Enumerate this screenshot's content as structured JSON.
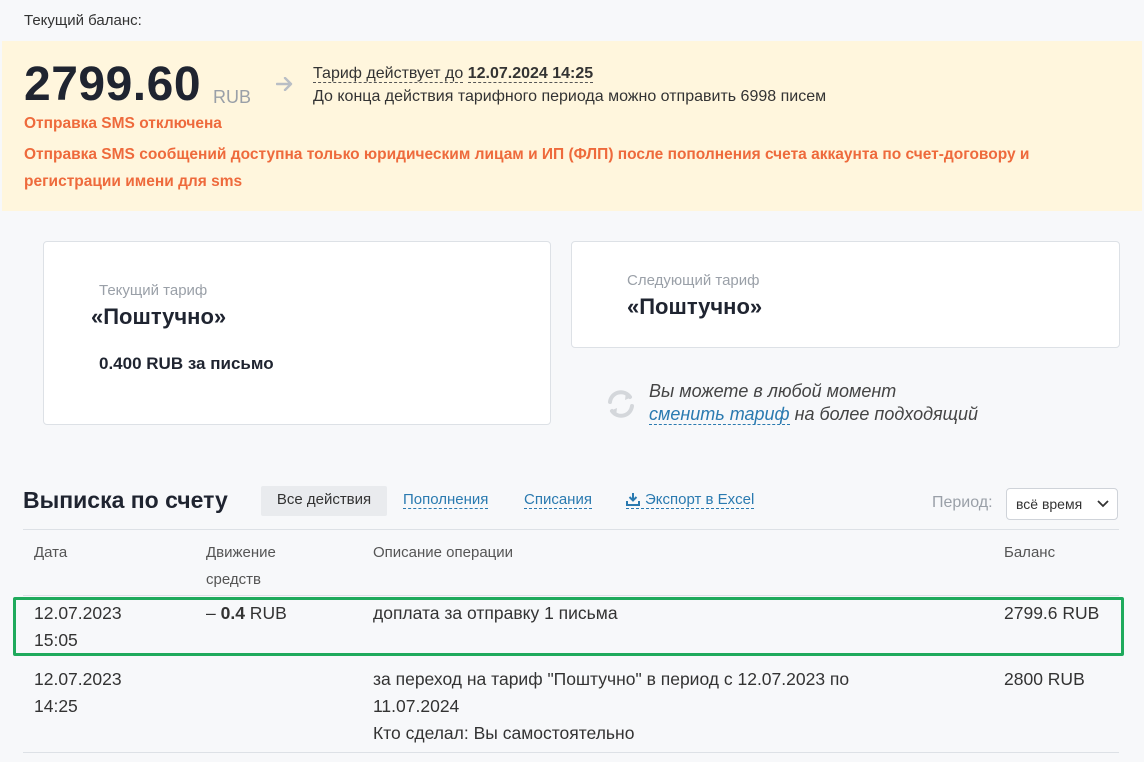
{
  "balance": {
    "caption": "Текущий баланс:",
    "amount": "2799.60",
    "currency": "RUB",
    "tariff_valid_label": "Тариф действует до",
    "tariff_valid_date": "12.07.2024 14:25",
    "period_info": "До конца действия тарифного периода можно отправить 6998 писем",
    "sms_off": "Отправка SMS отключена",
    "sms_info": "Отправка SMS сообщений доступна только юридическим лицам и ИП (ФЛП) после пополнения счета аккаунта по счет-договору и регистрации имени для sms"
  },
  "current_tariff": {
    "caption": "Текущий тариф",
    "name": "«Поштучно»",
    "price": "0.400 RUB за письмо"
  },
  "next_tariff": {
    "caption": "Следующий тариф",
    "name": "«Поштучно»"
  },
  "change": {
    "line1": "Вы можете в любой момент",
    "link": "сменить тариф",
    "line2_rest": " на более подходящий"
  },
  "statement": {
    "title": "Выписка по счету",
    "tabs": {
      "all": "Все действия",
      "topups": "Пополнения",
      "charges": "Списания",
      "export": "Экспорт в Excel"
    },
    "period_label": "Период:",
    "period_value": "всё время",
    "columns": {
      "date": "Дата",
      "movement_1": "Движение",
      "movement_2": "средств",
      "description": "Описание операции",
      "balance": "Баланс"
    },
    "rows": [
      {
        "date": "12.07.2023",
        "time": "15:05",
        "movement_sign": "– ",
        "movement_amount": "0.4",
        "movement_currency": " RUB",
        "description": "доплата за отправку 1 письма",
        "balance": "2799.6 RUB"
      },
      {
        "date": "12.07.2023",
        "time": "14:25",
        "description_1": "за переход на тариф \"Поштучно\" в период с 12.07.2023 по",
        "description_2": "11.07.2024",
        "description_3": "Кто сделал: Вы самостоятельно",
        "balance": "2800 RUB"
      }
    ]
  }
}
